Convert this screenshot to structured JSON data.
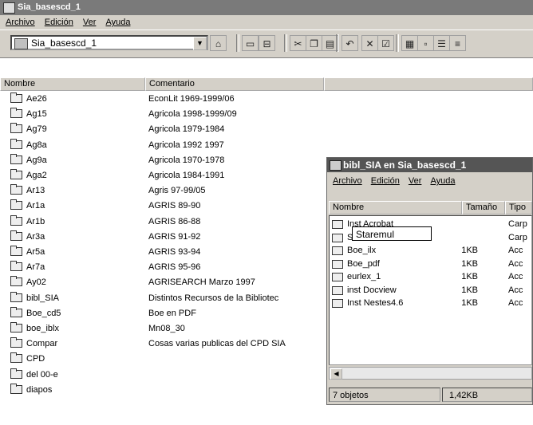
{
  "window": {
    "title": "Sia_basescd_1"
  },
  "menu": [
    "Archivo",
    "Edición",
    "Ver",
    "Ayuda"
  ],
  "toolbar": {
    "location": "Sia_basescd_1",
    "buttons": [
      {
        "name": "up-folder-icon",
        "glyph": "⌂"
      },
      {
        "name": "map-drive-icon",
        "glyph": "▭"
      },
      {
        "name": "disconnect-icon",
        "glyph": "⊟"
      },
      {
        "name": "cut-icon",
        "glyph": "✂"
      },
      {
        "name": "copy-icon",
        "glyph": "❐"
      },
      {
        "name": "paste-icon",
        "glyph": "▤"
      },
      {
        "name": "undo-icon",
        "glyph": "↶"
      },
      {
        "name": "delete-icon",
        "glyph": "✕"
      },
      {
        "name": "properties-icon",
        "glyph": "☑"
      },
      {
        "name": "large-icons-icon",
        "glyph": "▦"
      },
      {
        "name": "small-icons-icon",
        "glyph": "▫"
      },
      {
        "name": "list-view-icon",
        "glyph": "☰"
      },
      {
        "name": "details-view-icon",
        "glyph": "≡"
      }
    ]
  },
  "columns": {
    "name": "Nombre",
    "comment": "Comentario"
  },
  "items": [
    {
      "name": "Ae26",
      "comment": "EconLit 1969-1999/06"
    },
    {
      "name": "Ag15",
      "comment": "Agricola 1998-1999/09"
    },
    {
      "name": "Ag79",
      "comment": "Agricola 1979-1984"
    },
    {
      "name": "Ag8a",
      "comment": "Agricola 1992 1997"
    },
    {
      "name": "Ag9a",
      "comment": "Agricola 1970-1978"
    },
    {
      "name": "Aga2",
      "comment": "Agricola 1984-1991"
    },
    {
      "name": "Ar13",
      "comment": "Agris 97-99/05"
    },
    {
      "name": "Ar1a",
      "comment": "AGRIS 89-90"
    },
    {
      "name": "Ar1b",
      "comment": "AGRIS 86-88"
    },
    {
      "name": "Ar3a",
      "comment": "AGRIS 91-92"
    },
    {
      "name": "Ar5a",
      "comment": "AGRIS 93-94"
    },
    {
      "name": "Ar7a",
      "comment": "AGRIS 95-96"
    },
    {
      "name": "Ay02",
      "comment": "AGRISEARCH Marzo 1997"
    },
    {
      "name": "bibl_SIA",
      "comment": "Distintos Recursos de la Bibliotec"
    },
    {
      "name": "Boe_cd5",
      "comment": "Boe en PDF"
    },
    {
      "name": "boe_iblx",
      "comment": "Mn08_30"
    },
    {
      "name": "Compar",
      "comment": "Cosas varias publicas del CPD SIA"
    },
    {
      "name": "CPD",
      "comment": ""
    },
    {
      "name": "del 00-e",
      "comment": ""
    },
    {
      "name": "diapos",
      "comment": ""
    }
  ],
  "child_window": {
    "title": "bibl_SIA en Sia_basescd_1",
    "menu": [
      "Archivo",
      "Edición",
      "Ver",
      "Ayuda"
    ],
    "columns": {
      "name": "Nombre",
      "size": "Tamaño",
      "type": "Tipo"
    },
    "tooltip": "Staremul",
    "items": [
      {
        "name": "Inst Acrobat",
        "size": "",
        "type": "Carp"
      },
      {
        "name": "Staremul",
        "size": "",
        "type": "Carp"
      },
      {
        "name": "Boe_ilx",
        "size": "1KB",
        "type": "Acc"
      },
      {
        "name": "Boe_pdf",
        "size": "1KB",
        "type": "Acc"
      },
      {
        "name": "eurlex_1",
        "size": "1KB",
        "type": "Acc"
      },
      {
        "name": "inst Docview",
        "size": "1KB",
        "type": "Acc"
      },
      {
        "name": "Inst Nestes4.6",
        "size": "1KB",
        "type": "Acc"
      }
    ],
    "status": {
      "objects": "7 objetos",
      "size": "1,42KB"
    }
  }
}
